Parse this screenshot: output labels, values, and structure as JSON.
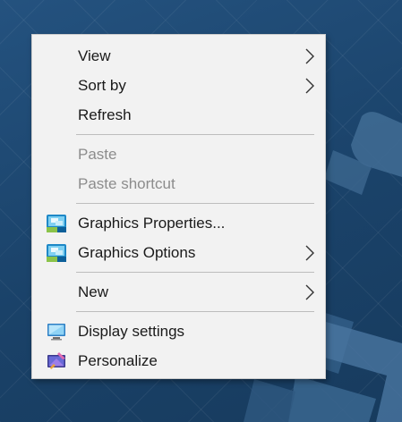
{
  "menu": {
    "groups": [
      {
        "items": [
          {
            "label": "View",
            "has_submenu": true,
            "enabled": true,
            "icon": null
          },
          {
            "label": "Sort by",
            "has_submenu": true,
            "enabled": true,
            "icon": null
          },
          {
            "label": "Refresh",
            "has_submenu": false,
            "enabled": true,
            "icon": null
          }
        ]
      },
      {
        "items": [
          {
            "label": "Paste",
            "has_submenu": false,
            "enabled": false,
            "icon": null
          },
          {
            "label": "Paste shortcut",
            "has_submenu": false,
            "enabled": false,
            "icon": null
          }
        ]
      },
      {
        "items": [
          {
            "label": "Graphics Properties...",
            "has_submenu": false,
            "enabled": true,
            "icon": "intel-graphics-icon"
          },
          {
            "label": "Graphics Options",
            "has_submenu": true,
            "enabled": true,
            "icon": "intel-graphics-icon"
          }
        ]
      },
      {
        "items": [
          {
            "label": "New",
            "has_submenu": true,
            "enabled": true,
            "icon": null
          }
        ]
      },
      {
        "items": [
          {
            "label": "Display settings",
            "has_submenu": false,
            "enabled": true,
            "icon": "display-monitor-icon"
          },
          {
            "label": "Personalize",
            "has_submenu": false,
            "enabled": true,
            "icon": "personalize-icon"
          }
        ]
      }
    ]
  },
  "colors": {
    "menu_background": "#f2f2f2",
    "text": "#1a1a1a",
    "disabled_text": "#8c8c8c",
    "separator": "#bdbdbd",
    "desktop_background": "#1d466f"
  }
}
